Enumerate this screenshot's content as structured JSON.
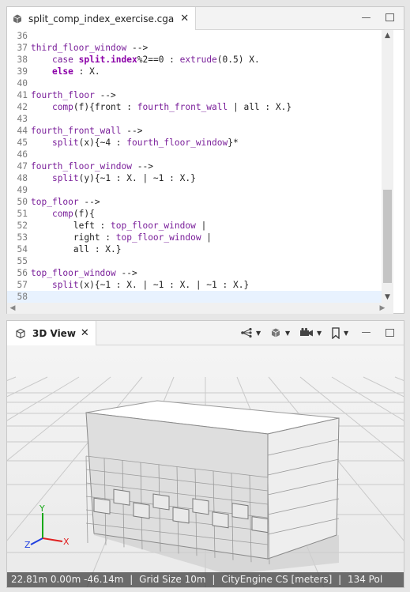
{
  "editor": {
    "tab_title": "split_comp_index_exercise.cga",
    "lines": [
      {
        "n": "36",
        "segs": []
      },
      {
        "n": "37",
        "segs": [
          {
            "t": "third_floor_window",
            "c": "rule"
          },
          {
            "t": " -->",
            "c": "op"
          }
        ]
      },
      {
        "n": "38",
        "segs": [
          {
            "t": "    ",
            "c": "op"
          },
          {
            "t": "case",
            "c": "fn"
          },
          {
            "t": " ",
            "c": "op"
          },
          {
            "t": "split.index",
            "c": "kw"
          },
          {
            "t": "%2==0 : ",
            "c": "op"
          },
          {
            "t": "extrude",
            "c": "fn"
          },
          {
            "t": "(0.5) X.",
            "c": "op"
          }
        ]
      },
      {
        "n": "39",
        "segs": [
          {
            "t": "    ",
            "c": "op"
          },
          {
            "t": "else",
            "c": "kw"
          },
          {
            "t": " : X.",
            "c": "op"
          }
        ]
      },
      {
        "n": "40",
        "segs": []
      },
      {
        "n": "41",
        "segs": [
          {
            "t": "fourth_floor",
            "c": "rule"
          },
          {
            "t": " -->",
            "c": "op"
          }
        ]
      },
      {
        "n": "42",
        "segs": [
          {
            "t": "    ",
            "c": "op"
          },
          {
            "t": "comp",
            "c": "fn"
          },
          {
            "t": "(f){front : ",
            "c": "op"
          },
          {
            "t": "fourth_front_wall",
            "c": "rule"
          },
          {
            "t": " | all : X.}",
            "c": "op"
          }
        ]
      },
      {
        "n": "43",
        "segs": []
      },
      {
        "n": "44",
        "segs": [
          {
            "t": "fourth_front_wall",
            "c": "rule"
          },
          {
            "t": " -->",
            "c": "op"
          }
        ]
      },
      {
        "n": "45",
        "segs": [
          {
            "t": "    ",
            "c": "op"
          },
          {
            "t": "split",
            "c": "fn"
          },
          {
            "t": "(x){~4 : ",
            "c": "op"
          },
          {
            "t": "fourth_floor_window",
            "c": "rule"
          },
          {
            "t": "}*",
            "c": "op"
          }
        ]
      },
      {
        "n": "46",
        "segs": []
      },
      {
        "n": "47",
        "segs": [
          {
            "t": "fourth_floor_window",
            "c": "rule"
          },
          {
            "t": " -->",
            "c": "op"
          }
        ]
      },
      {
        "n": "48",
        "segs": [
          {
            "t": "    ",
            "c": "op"
          },
          {
            "t": "split",
            "c": "fn"
          },
          {
            "t": "(y){~1 : X. | ~1 : X.}",
            "c": "op"
          }
        ]
      },
      {
        "n": "49",
        "segs": []
      },
      {
        "n": "50",
        "segs": [
          {
            "t": "top_floor",
            "c": "rule"
          },
          {
            "t": " -->",
            "c": "op"
          }
        ]
      },
      {
        "n": "51",
        "segs": [
          {
            "t": "    ",
            "c": "op"
          },
          {
            "t": "comp",
            "c": "fn"
          },
          {
            "t": "(f){",
            "c": "op"
          }
        ]
      },
      {
        "n": "52",
        "segs": [
          {
            "t": "        left : ",
            "c": "op"
          },
          {
            "t": "top_floor_window",
            "c": "rule"
          },
          {
            "t": " |",
            "c": "op"
          }
        ]
      },
      {
        "n": "53",
        "segs": [
          {
            "t": "        right : ",
            "c": "op"
          },
          {
            "t": "top_floor_window",
            "c": "rule"
          },
          {
            "t": " |",
            "c": "op"
          }
        ]
      },
      {
        "n": "54",
        "segs": [
          {
            "t": "        all : X.}",
            "c": "op"
          }
        ]
      },
      {
        "n": "55",
        "segs": []
      },
      {
        "n": "56",
        "segs": [
          {
            "t": "top_floor_window",
            "c": "rule"
          },
          {
            "t": " -->",
            "c": "op"
          }
        ]
      },
      {
        "n": "57",
        "segs": [
          {
            "t": "    ",
            "c": "op"
          },
          {
            "t": "split",
            "c": "fn"
          },
          {
            "t": "(x){~1 : X. | ~1 : X. | ~1 : X.}",
            "c": "op"
          }
        ]
      },
      {
        "n": "58",
        "segs": [],
        "current": true
      }
    ]
  },
  "view": {
    "tab_title": "3D View",
    "toolbar_icons": [
      "scene-graph-icon",
      "display-mode-icon",
      "camera-icon",
      "bookmark-icon"
    ]
  },
  "status_bar": {
    "coords": "22.81m 0.00m -46.14m",
    "grid": "Grid Size 10m",
    "crs": "CityEngine CS [meters]",
    "polys": "134 Pol"
  },
  "axes": {
    "x": "X",
    "y": "Y",
    "z": "Z"
  },
  "colors": {
    "rule": "#7a1f9a",
    "keyword": "#8b00a8",
    "axis_x": "#e02020",
    "axis_y": "#18a818",
    "axis_z": "#2040e0"
  }
}
